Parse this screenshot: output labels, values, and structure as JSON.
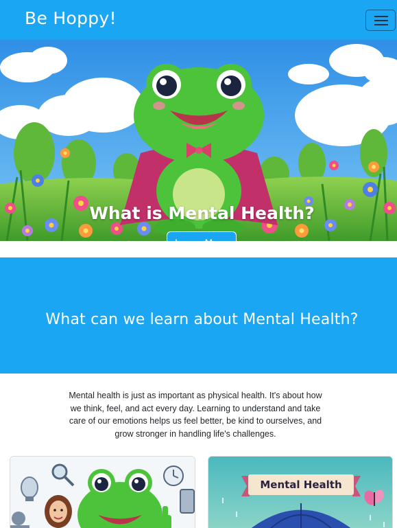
{
  "navbar": {
    "brand": "Be Hoppy!",
    "menu_icon": "hamburger-icon"
  },
  "hero": {
    "title": "What is Mental Health?",
    "button_label": "Learn More",
    "image": "cartoon-frog-superhero-in-flower-meadow"
  },
  "section": {
    "heading": "What can we learn about Mental Health?",
    "intro": "Mental health is just as important as physical health. It's about how we think, feel, and act every day. Learning to understand and take care of our emotions helps us feel better, be kind to ourselves, and grow stronger in handling life's challenges."
  },
  "cards": [
    {
      "image": "frog-with-thinking-icons"
    },
    {
      "image": "mental-health-umbrella",
      "banner": "Mental Health"
    }
  ],
  "colors": {
    "primary": "#1aa6f3",
    "text": "#212529",
    "white": "#ffffff"
  }
}
